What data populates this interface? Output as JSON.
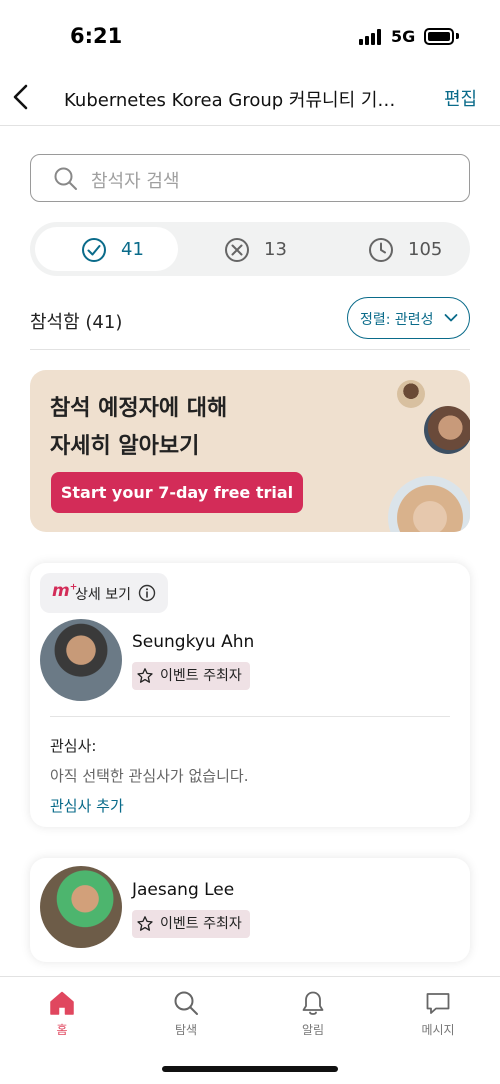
{
  "status_bar": {
    "time": "6:21",
    "network": "5G"
  },
  "nav": {
    "title": "Kubernetes Korea Group 커뮤니티 기…",
    "edit_label": "편집"
  },
  "search": {
    "placeholder": "참석자 검색"
  },
  "segments": [
    {
      "icon": "check-circle-icon",
      "count": "41",
      "active": true
    },
    {
      "icon": "x-circle-icon",
      "count": "13",
      "active": false
    },
    {
      "icon": "clock-icon",
      "count": "105",
      "active": false
    }
  ],
  "attendance": {
    "heading": "참석함 (41)",
    "sort_label": "정렬: 관련성"
  },
  "promo": {
    "line1": "참석 예정자에 대해",
    "line2": "자세히 알아보기",
    "button": "Start your 7-day free trial"
  },
  "attendees": [
    {
      "details_label": "상세 보기",
      "logo": "m",
      "name": "Seungkyu Ahn",
      "role": "이벤트 주최자",
      "interests_heading": "관심사:",
      "interests_empty": "아직 선택한 관심사가 없습니다.",
      "add_interest": "관심사 추가"
    },
    {
      "name": "Jaesang Lee",
      "role": "이벤트 주최자"
    }
  ],
  "tabbar": [
    {
      "label": "홈",
      "icon": "home-icon",
      "active": true
    },
    {
      "label": "탐색",
      "icon": "search-icon",
      "active": false
    },
    {
      "label": "알림",
      "icon": "bell-icon",
      "active": false
    },
    {
      "label": "메시지",
      "icon": "chat-icon",
      "active": false
    }
  ],
  "colors": {
    "accent": "#0a6b8a",
    "brand": "#d32c58",
    "promo_bg": "#efe0cf"
  }
}
